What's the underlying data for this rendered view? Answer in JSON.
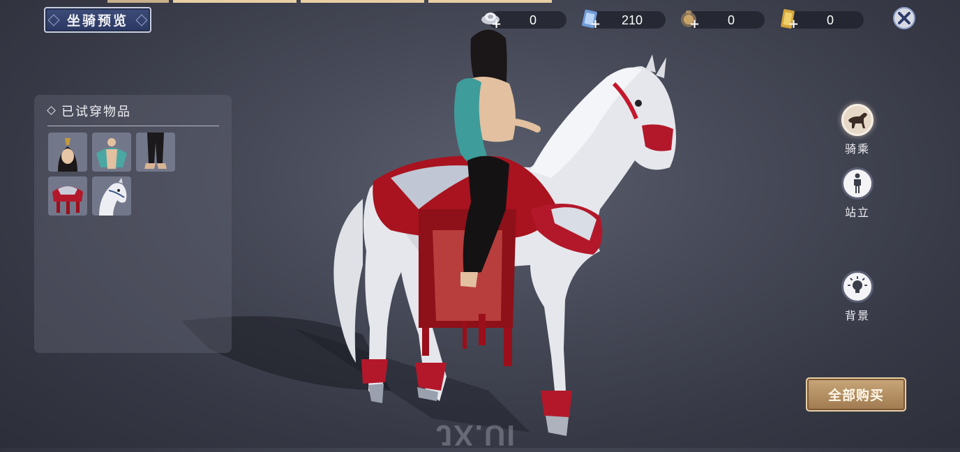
{
  "header": {
    "title": "坐骑预览",
    "tab_count": 4
  },
  "currencies": [
    {
      "name": "silver-ingot",
      "value": "0"
    },
    {
      "name": "ticket",
      "value": "210"
    },
    {
      "name": "coin-pouch",
      "value": "0"
    },
    {
      "name": "gold-token",
      "value": "0"
    }
  ],
  "panel": {
    "title": "已试穿物品",
    "items": [
      {
        "icon": "hairstyle-item-icon"
      },
      {
        "icon": "top-outfit-item-icon"
      },
      {
        "icon": "pants-item-icon"
      },
      {
        "icon": "saddle-item-icon"
      },
      {
        "icon": "white-horse-item-icon"
      }
    ]
  },
  "side_buttons": {
    "ride": "骑乘",
    "stand": "站立",
    "background": "背景"
  },
  "buy_all": "全部购买",
  "watermark": "JX.UI",
  "colors": {
    "banner": "#2f3c68",
    "gold_button": "#b8936a",
    "accent_red": "#b3182a"
  }
}
